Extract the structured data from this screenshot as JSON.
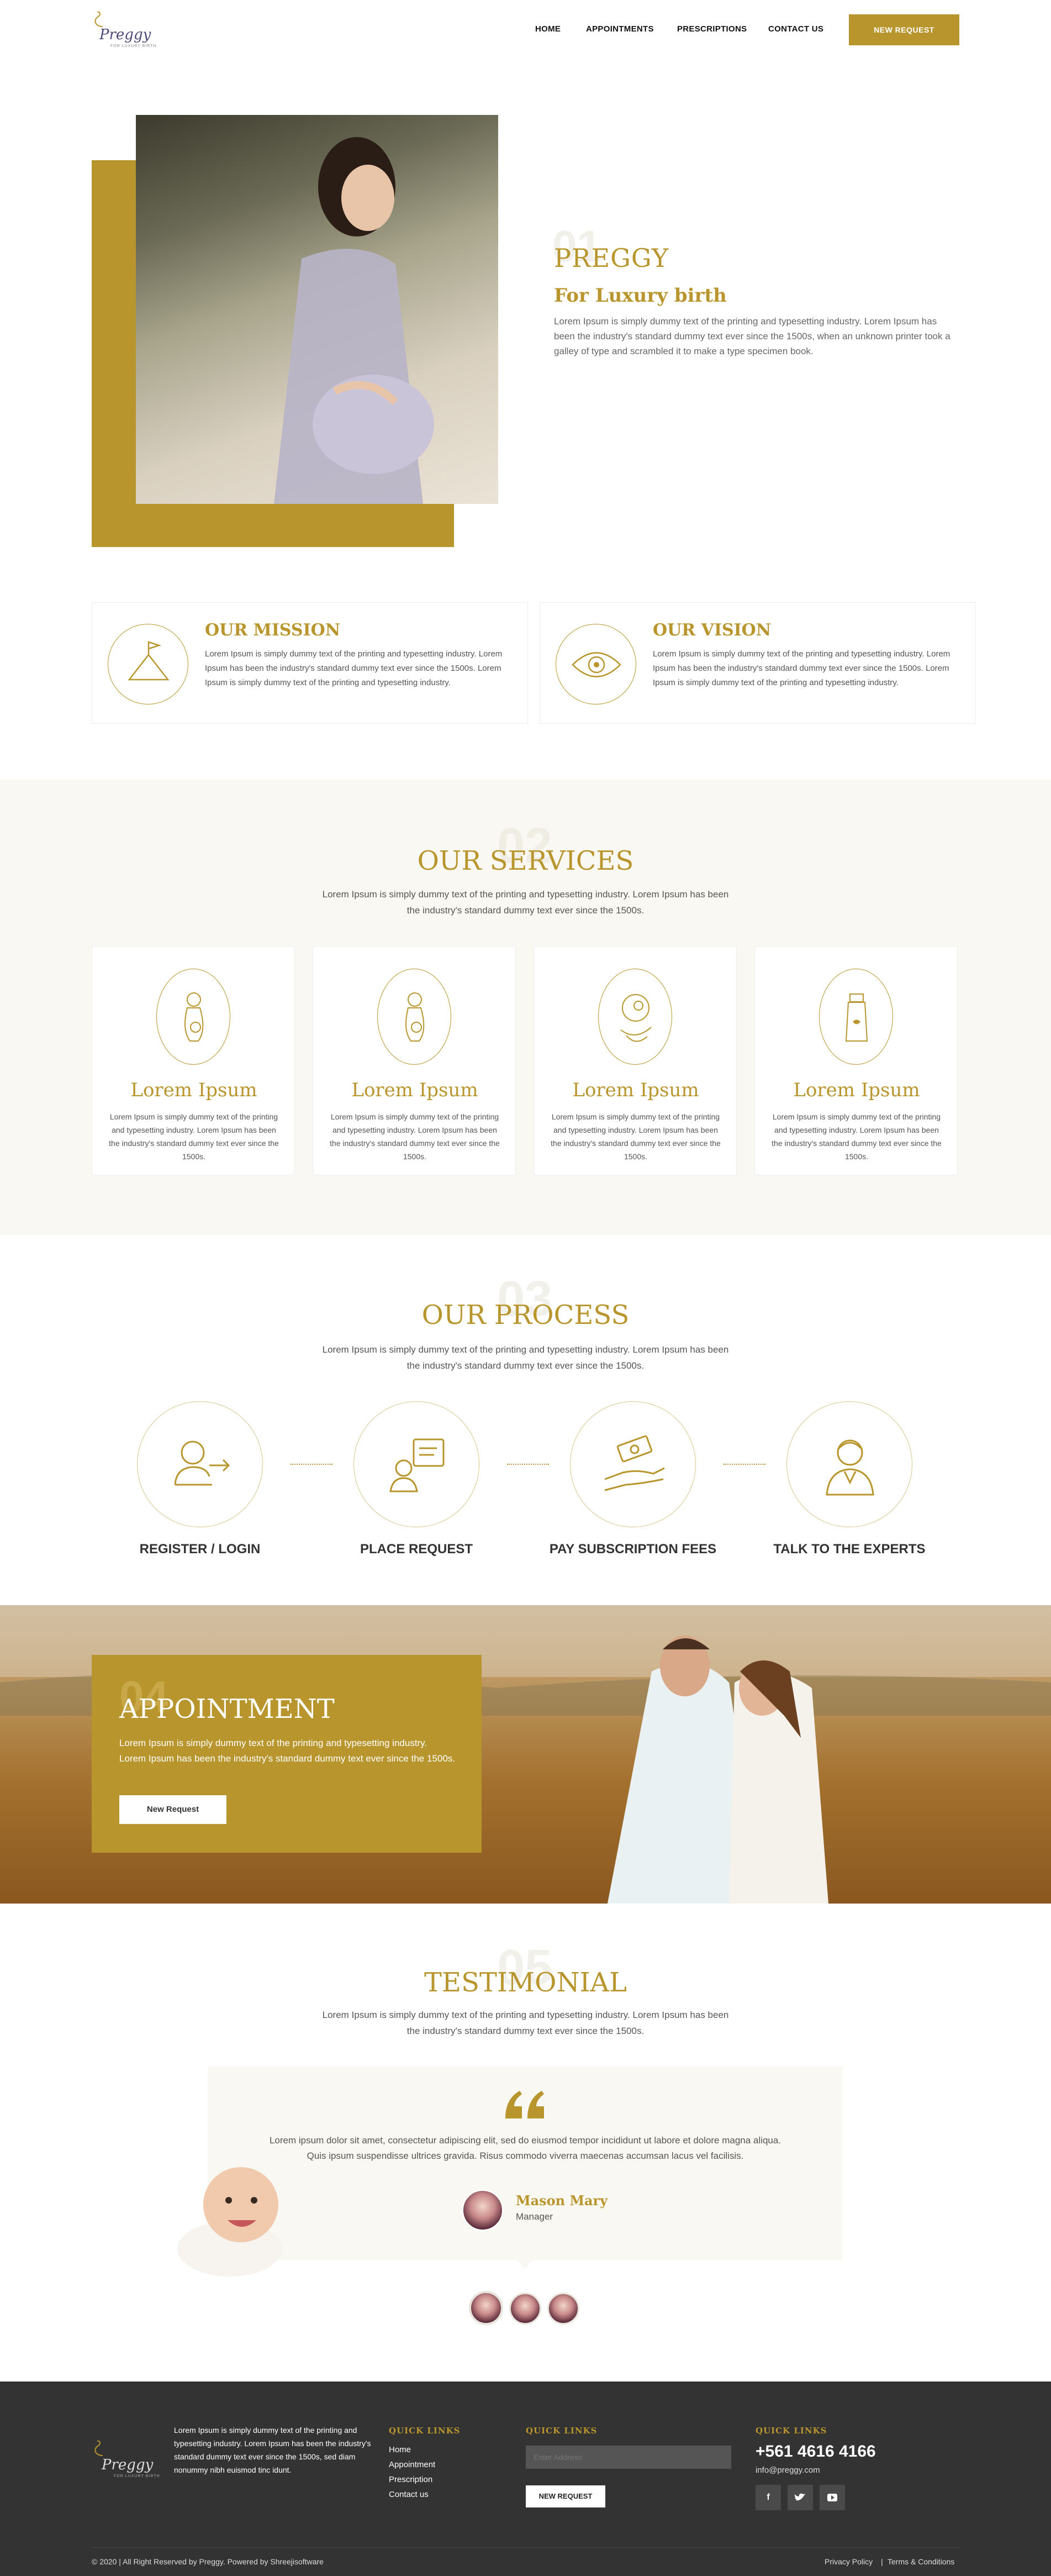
{
  "header": {
    "logo_text": "Preggy",
    "logo_sub": "FOR LUXURY BIRTH",
    "nav": [
      "HOME",
      "APPOINTMENTS",
      "PRESCRIPTIONS",
      "CONTACT US"
    ],
    "cta": "NEW REQUEST"
  },
  "hero": {
    "num": "01",
    "title": "PREGGY",
    "subtitle": "For Luxury birth",
    "text": "Lorem Ipsum is simply dummy text of the printing and typesetting industry. Lorem Ipsum has been the industry's standard dummy text ever since the 1500s, when an unknown printer took a galley of type and scrambled it to make a type specimen book."
  },
  "mission": {
    "title": "OUR MISSION",
    "text": "Lorem Ipsum is simply dummy text of the printing and typesetting industry. Lorem Ipsum has been the industry's standard dummy text ever since the 1500s. Lorem Ipsum is simply dummy text of the printing and typesetting industry."
  },
  "vision": {
    "title": "OUR VISION",
    "text": "Lorem Ipsum is simply dummy text of the printing and typesetting industry. Lorem Ipsum has been the industry's standard dummy text ever since the 1500s. Lorem Ipsum is simply dummy text of the printing and typesetting industry."
  },
  "services": {
    "num": "02",
    "title": "OUR SERVICES",
    "desc": "Lorem Ipsum is simply dummy text of the printing and typesetting industry. Lorem Ipsum has been the industry's standard dummy text ever since the 1500s.",
    "cards": [
      {
        "title": "Lorem Ipsum",
        "text": "Lorem Ipsum is simply dummy text of the printing and typesetting industry. Lorem Ipsum has been the industry's standard dummy text ever since the 1500s."
      },
      {
        "title": "Lorem Ipsum",
        "text": "Lorem Ipsum is simply dummy text of the printing and typesetting industry. Lorem Ipsum has been the industry's standard dummy text ever since the 1500s."
      },
      {
        "title": "Lorem Ipsum",
        "text": "Lorem Ipsum is simply dummy text of the printing and typesetting industry. Lorem Ipsum has been the industry's standard dummy text ever since the 1500s."
      },
      {
        "title": "Lorem Ipsum",
        "text": "Lorem Ipsum is simply dummy text of the printing and typesetting industry. Lorem Ipsum has been the industry's standard dummy text ever since the 1500s."
      }
    ]
  },
  "process": {
    "num": "03",
    "title": "OUR PROCESS",
    "desc": "Lorem Ipsum is simply dummy text of the printing and typesetting industry. Lorem Ipsum has been the industry's standard dummy text ever since the 1500s.",
    "steps": [
      "REGISTER / LOGIN",
      "PLACE REQUEST",
      "PAY SUBSCRIPTION FEES",
      "TALK TO THE EXPERTS"
    ]
  },
  "appointment": {
    "num": "04",
    "title": "APPOINTMENT",
    "text": "Lorem Ipsum is simply dummy text of the printing and typesetting industry. Lorem Ipsum has been the industry's standard dummy text ever since the 1500s.",
    "button": "New Request"
  },
  "testimonial": {
    "num": "05",
    "title": "TESTIMONIAL",
    "desc": "Lorem Ipsum is simply dummy text of the printing and typesetting industry. Lorem Ipsum has been the industry's standard dummy text ever since the 1500s.",
    "quote": "Lorem ipsum dolor sit amet, consectetur adipiscing elit, sed do eiusmod tempor incididunt ut labore et dolore magna aliqua. Quis ipsum suspendisse ultrices gravida. Risus commodo viverra maecenas accumsan lacus vel facilisis.",
    "name": "Mason Mary",
    "role": "Manager"
  },
  "footer": {
    "about": "Lorem Ipsum is simply dummy text of the printing and typesetting industry. Lorem Ipsum has been the industry's standard dummy text ever since the 1500s, sed diam nonummy nibh euismod tinc idunt.",
    "quick_links_title": "QUICK LINKS",
    "links": [
      "Home",
      "Appointment",
      "Prescription",
      "Contact us"
    ],
    "newsletter_title": "QUICK LINKS",
    "newsletter_placeholder": "Enter Address",
    "newsletter_button": "NEW REQUEST",
    "contact_title": "QUICK LINKS",
    "phone": "+561 4616 4166",
    "email": "info@preggy.com",
    "copyright": "© 2020 | All Right Reserved by Preggy. Powered by Shreejisoftware",
    "privacy": "Privacy Policy",
    "separator": "|",
    "terms": "Terms & Conditions"
  }
}
